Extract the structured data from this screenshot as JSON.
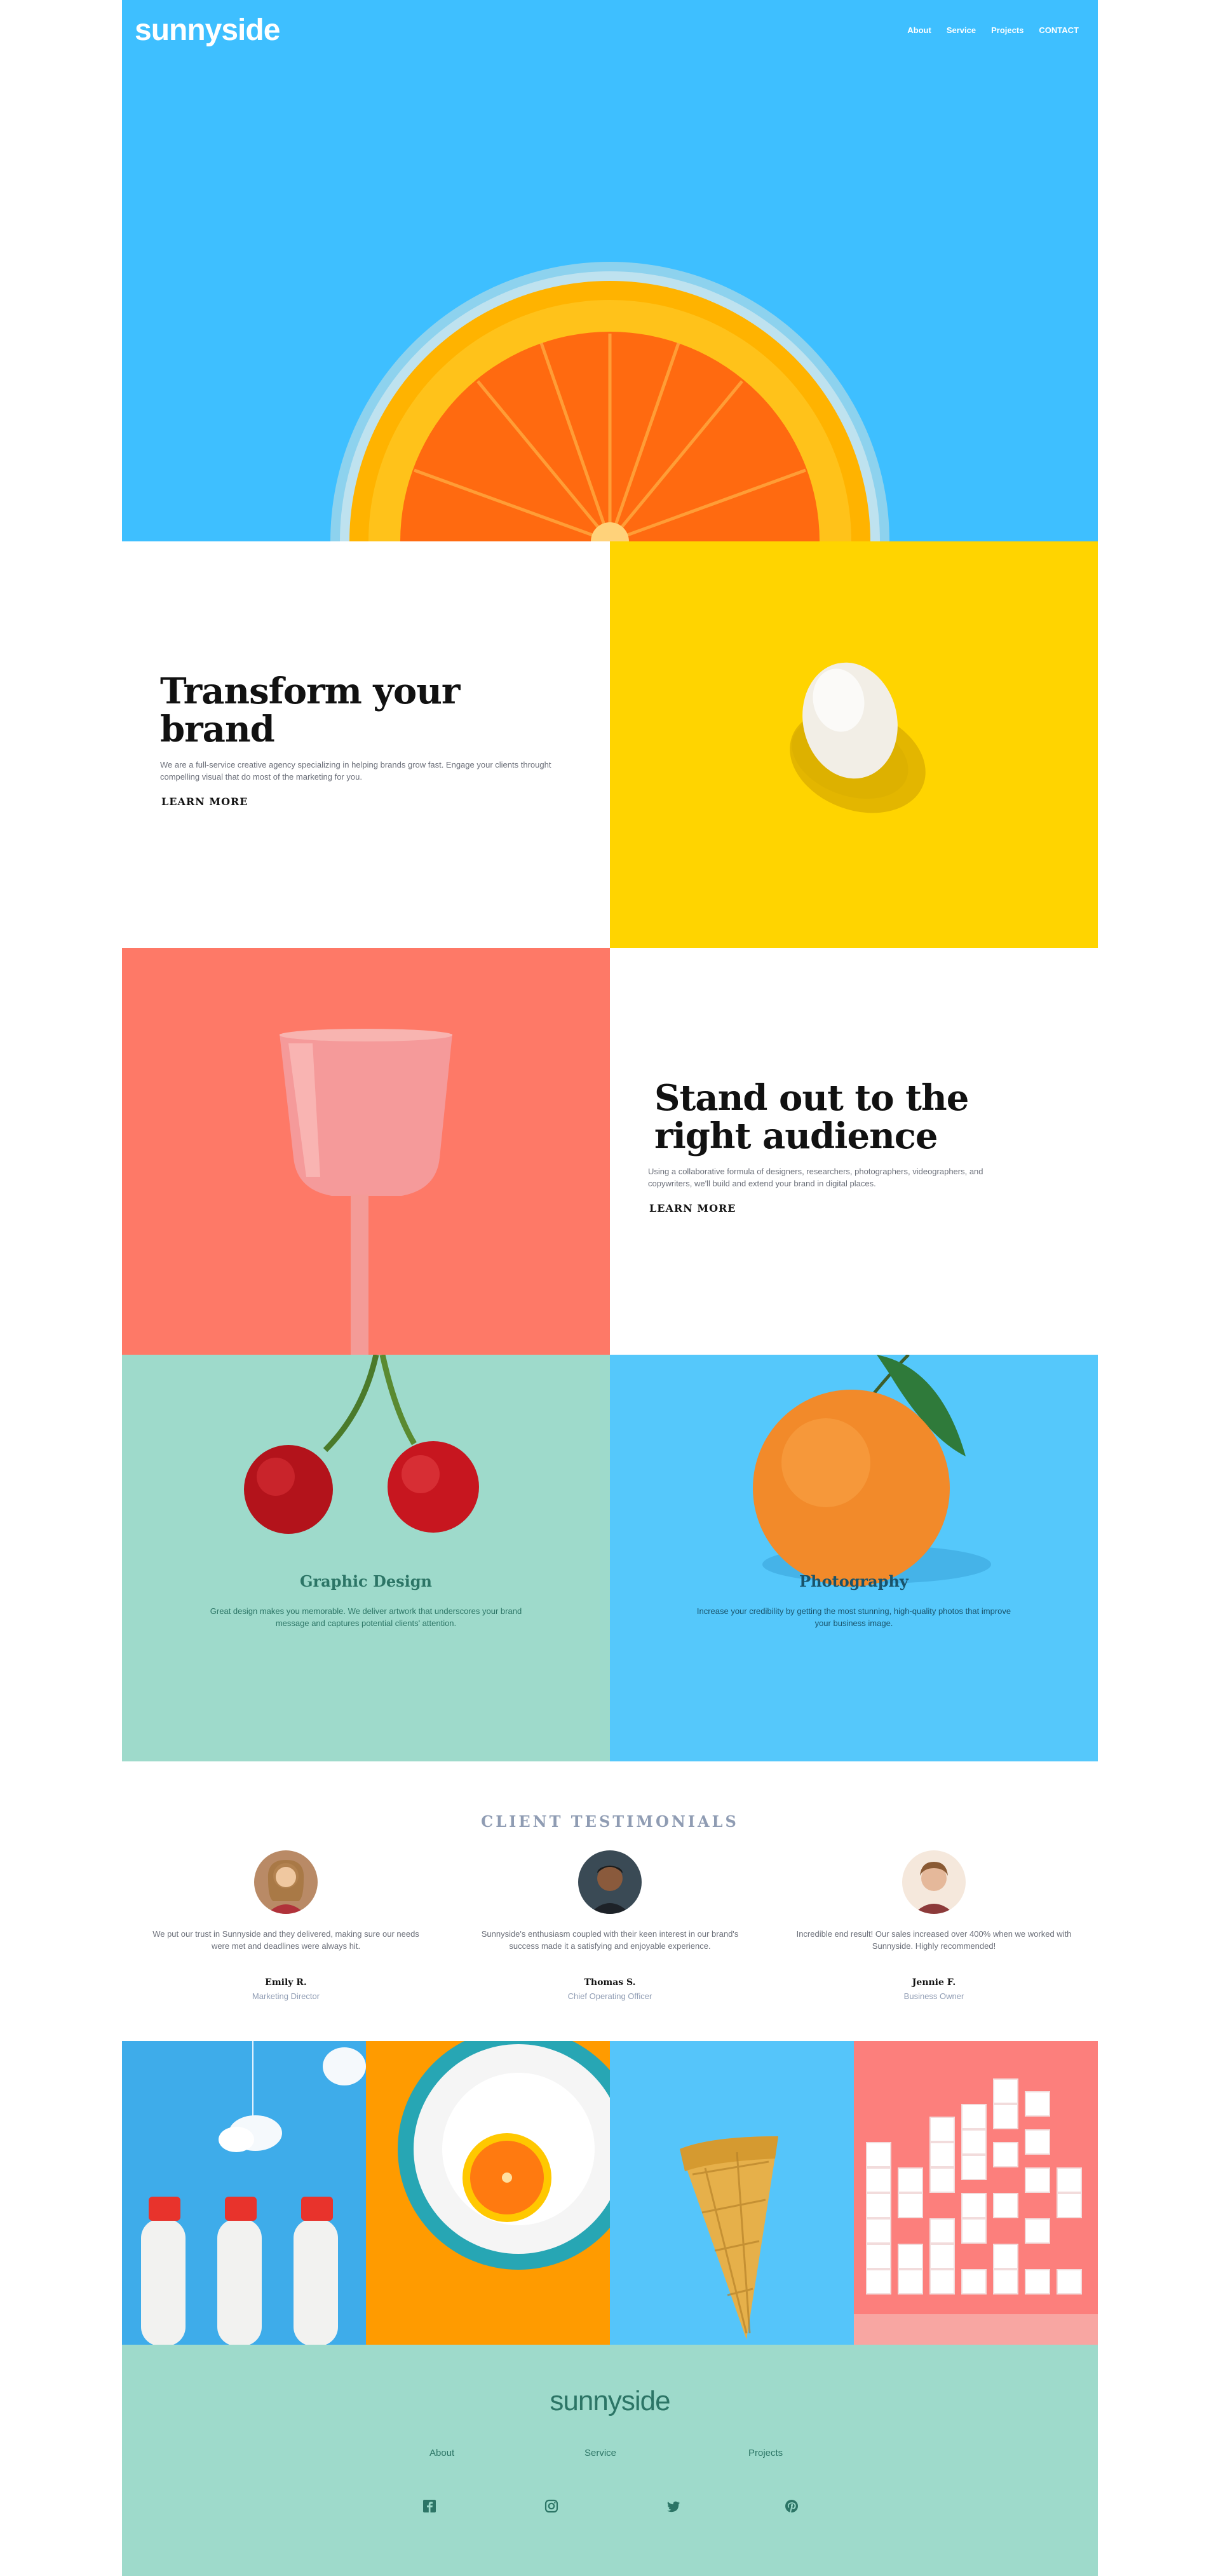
{
  "header": {
    "logo": "sunnyside",
    "nav": [
      "About",
      "Service",
      "Projects",
      "CONTACT"
    ]
  },
  "transform": {
    "title": "Transform your brand",
    "text": "We are a full-service creative agency specializing in helping brands grow fast. Engage your clients throught compelling visual that do most of the marketing for you.",
    "link": "LEARN MORE"
  },
  "standout": {
    "title": "Stand out to the right audience",
    "text": "Using a collaborative formula of designers, researchers, photographers, videographers, and copywriters, we'll build and extend your brand in digital places.",
    "link": "LEARN MORE"
  },
  "services": [
    {
      "title": "Graphic Design",
      "text": "Great design makes you memorable. We deliver artwork that underscores your brand message and captures potential clients' attention."
    },
    {
      "title": "Photography",
      "text": "Increase your credibility by getting the most stunning, high-quality photos that improve your business image."
    }
  ],
  "testimonials": {
    "title": "CLIENT TESTIMONIALS",
    "items": [
      {
        "quote": "We put our trust in Sunnyside and they delivered, making sure our needs were met and deadlines were always hit.",
        "name": "Emily R.",
        "role": "Marketing Director"
      },
      {
        "quote": "Sunnyside's enthusiasm coupled with their keen interest in our brand's success made it a satisfying and enjoyable experience.",
        "name": "Thomas S.",
        "role": "Chief Operating Officer"
      },
      {
        "quote": "Incredible end result! Our sales increased over 400% when we worked with Sunnyside. Highly recommended!",
        "name": "Jennie F.",
        "role": "Business Owner"
      }
    ]
  },
  "footer": {
    "logo": "sunnyside",
    "nav": [
      "About",
      "Service",
      "Projects"
    ],
    "social_icons": [
      "facebook-icon",
      "instagram-icon",
      "twitter-icon",
      "pinterest-icon"
    ]
  },
  "colors": {
    "hero_blue": "#3ebfff",
    "yellow": "#ffd400",
    "salmon": "#fe7967",
    "mint": "#9edacb",
    "footer_text": "#2c7566"
  }
}
